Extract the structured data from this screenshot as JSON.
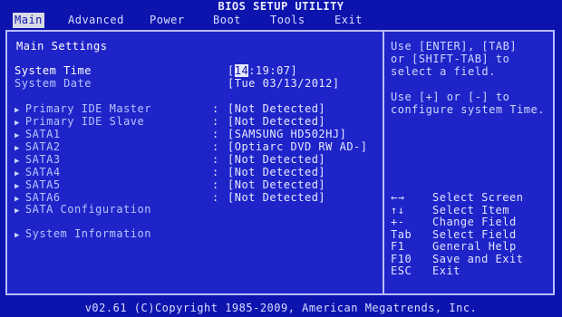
{
  "title": "BIOS SETUP UTILITY",
  "menu": {
    "items": [
      {
        "label": "Main",
        "active": true
      },
      {
        "label": "Advanced",
        "active": false
      },
      {
        "label": "Power",
        "active": false
      },
      {
        "label": "Boot",
        "active": false
      },
      {
        "label": "Tools",
        "active": false
      },
      {
        "label": "Exit",
        "active": false
      }
    ]
  },
  "main": {
    "section_title": "Main Settings",
    "system_time": {
      "label": "System Time",
      "value_selected": "14",
      "value_rest": ":19:07]",
      "bracket_open": "["
    },
    "system_date": {
      "label": "System Date",
      "value": "[Tue 03/13/2012]"
    },
    "devices": [
      {
        "label": "Primary IDE Master",
        "colon": ":",
        "value": "[Not Detected]"
      },
      {
        "label": "Primary IDE Slave",
        "colon": ":",
        "value": "[Not Detected]"
      },
      {
        "label": "SATA1",
        "colon": ":",
        "value": "[SAMSUNG HD502HJ]"
      },
      {
        "label": "SATA2",
        "colon": ":",
        "value": "[Optiarc DVD RW AD-]"
      },
      {
        "label": "SATA3",
        "colon": ":",
        "value": "[Not Detected]"
      },
      {
        "label": "SATA4",
        "colon": ":",
        "value": "[Not Detected]"
      },
      {
        "label": "SATA5",
        "colon": ":",
        "value": "[Not Detected]"
      },
      {
        "label": "SATA6",
        "colon": ":",
        "value": "[Not Detected]"
      }
    ],
    "sata_configuration": "SATA Configuration",
    "system_information": "System Information"
  },
  "help": {
    "line1": "Use [ENTER], [TAB]",
    "line2": "or [SHIFT-TAB] to",
    "line3": "select a field.",
    "line4": "Use [+] or [-] to",
    "line5": "configure system Time."
  },
  "keys": [
    {
      "key": "←→",
      "desc": "Select Screen"
    },
    {
      "key": "↑↓",
      "desc": "Select Item"
    },
    {
      "key": "+-",
      "desc": "Change Field"
    },
    {
      "key": "Tab",
      "desc": "Select Field"
    },
    {
      "key": "F1",
      "desc": "General Help"
    },
    {
      "key": "F10",
      "desc": "Save and Exit"
    },
    {
      "key": "ESC",
      "desc": "Exit"
    }
  ],
  "footer": "v02.61 (C)Copyright 1985-2009, American Megatrends, Inc.",
  "colors": {
    "background": "#0d13ad",
    "panel": "#1f24c8",
    "border": "#b8bcff"
  },
  "icons": {
    "submenu_arrow": "triangle-right-icon"
  }
}
